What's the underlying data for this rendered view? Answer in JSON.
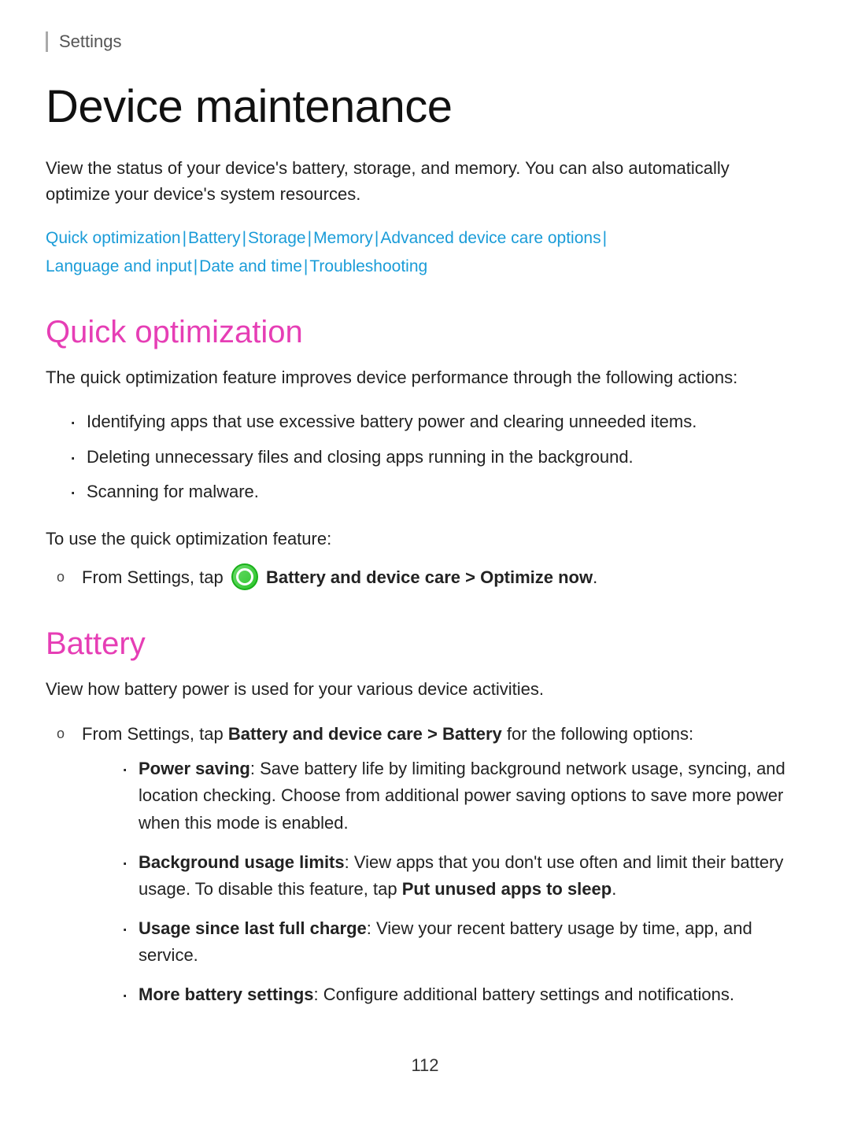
{
  "breadcrumb": "Settings",
  "page_title": "Device maintenance",
  "intro_text": "View the status of your device's battery, storage, and memory. You can also automatically optimize your device's system resources.",
  "nav_links": [
    "Quick optimization",
    "Battery",
    "Storage",
    "Memory",
    "Advanced device care options",
    "Language and input",
    "Date and time",
    "Troubleshooting"
  ],
  "sections": {
    "quick_optimization": {
      "title": "Quick optimization",
      "intro": "The quick optimization feature improves device performance through the following actions:",
      "bullets": [
        "Identifying apps that use excessive battery power and clearing unneeded items.",
        "Deleting unnecessary files and closing apps running in the background.",
        "Scanning for malware."
      ],
      "use_text": "To use the quick optimization feature:",
      "steps": [
        {
          "prefix": "From Settings, tap",
          "bold_text": "Battery and device care > Optimize now",
          "suffix": "."
        }
      ]
    },
    "battery": {
      "title": "Battery",
      "intro": "View how battery power is used for your various device activities.",
      "steps": [
        {
          "prefix": "From Settings, tap",
          "bold_text": "Battery and device care > Battery",
          "suffix": "for the following options:"
        }
      ],
      "sub_bullets": [
        {
          "bold": "Power saving",
          "text": ": Save battery life by limiting background network usage, syncing, and location checking. Choose from additional power saving options to save more power when this mode is enabled."
        },
        {
          "bold": "Background usage limits",
          "text": ": View apps that you don't use often and limit their battery usage. To disable this feature, tap",
          "trailing_bold": "Put unused apps to sleep",
          "trailing": "."
        },
        {
          "bold": "Usage since last full charge",
          "text": ": View your recent battery usage by time, app, and service."
        },
        {
          "bold": "More battery settings",
          "text": ": Configure additional battery settings and notifications."
        }
      ]
    }
  },
  "page_number": "112"
}
